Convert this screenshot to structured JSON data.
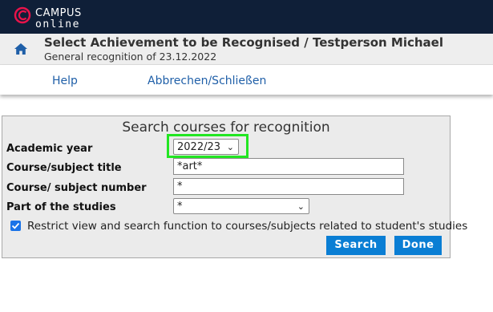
{
  "app": {
    "logo_line1": "CAMPUS",
    "logo_line2": "online",
    "brand_color": "#e8134a"
  },
  "header": {
    "title": "Select Achievement to be Recognised  / Testperson Michael",
    "subtitle": "General recognition of 23.12.2022",
    "home_icon": "home-icon"
  },
  "actions": {
    "help": "Help",
    "cancel_close": "Abbrechen/Schließen"
  },
  "form": {
    "title": "Search courses for recognition",
    "academic_year": {
      "label": "Academic year",
      "value": "2022/23"
    },
    "course_title": {
      "label": "Course/subject title",
      "value": "*art*"
    },
    "course_number": {
      "label": "Course/ subject number",
      "value": "*"
    },
    "part_of_studies": {
      "label": "Part of the studies",
      "value": "*"
    },
    "restrict": {
      "label": "Restrict view and search function to courses/subjects related to student's studies",
      "checked": true
    },
    "search_button": "Search",
    "done_button": "Done",
    "highlight_color": "#22e622",
    "button_color": "#0a7ed4"
  }
}
